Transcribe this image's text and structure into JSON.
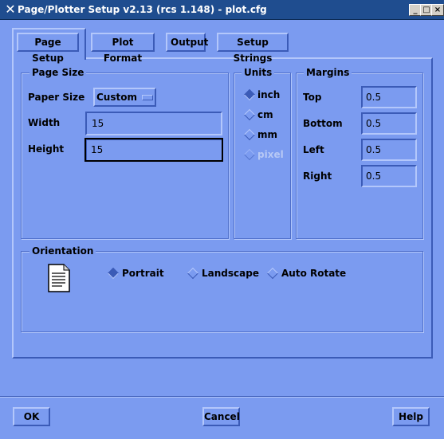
{
  "window": {
    "title": "Page/Plotter Setup v2.13 (rcs 1.148) - plot.cfg",
    "controls": [
      "_",
      "□",
      "×"
    ]
  },
  "tabs": [
    {
      "label": "Page Setup",
      "active": true
    },
    {
      "label": "Plot Format",
      "active": false
    },
    {
      "label": "Output",
      "active": false
    },
    {
      "label": "Setup Strings",
      "active": false
    }
  ],
  "page_size": {
    "title": "Page Size",
    "paper_size_label": "Paper Size",
    "paper_size_value": "Custom",
    "width_label": "Width",
    "width_value": "15",
    "height_label": "Height",
    "height_value": "15"
  },
  "units": {
    "title": "Units",
    "options": [
      {
        "label": "inch",
        "selected": true,
        "disabled": false
      },
      {
        "label": "cm",
        "selected": false,
        "disabled": false
      },
      {
        "label": "mm",
        "selected": false,
        "disabled": false
      },
      {
        "label": "pixel",
        "selected": false,
        "disabled": true
      }
    ]
  },
  "margins": {
    "title": "Margins",
    "fields": [
      {
        "label": "Top",
        "value": "0.5"
      },
      {
        "label": "Bottom",
        "value": "0.5"
      },
      {
        "label": "Left",
        "value": "0.5"
      },
      {
        "label": "Right",
        "value": "0.5"
      }
    ]
  },
  "orientation": {
    "title": "Orientation",
    "options": [
      {
        "label": "Portrait",
        "selected": true
      },
      {
        "label": "Landscape",
        "selected": false
      },
      {
        "label": "Auto Rotate",
        "selected": false
      }
    ]
  },
  "buttons": {
    "ok": "OK",
    "cancel": "Cancel",
    "help": "Help"
  },
  "colors": {
    "background": "#7b9bf0",
    "titlebar": "#1f4d8f",
    "highlight": "#b3c7fb",
    "shadow": "#3b5bb7"
  }
}
